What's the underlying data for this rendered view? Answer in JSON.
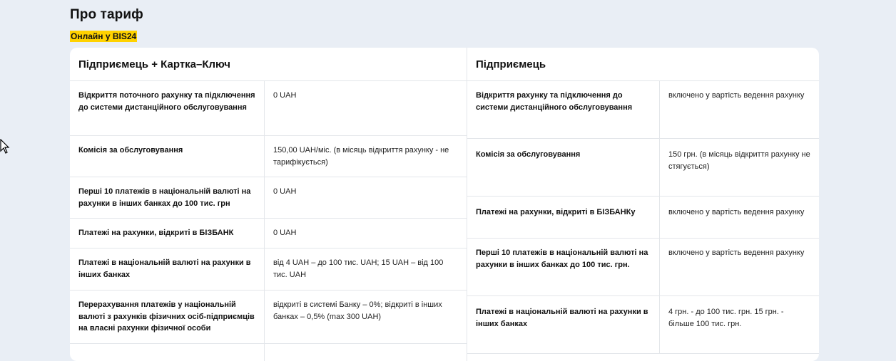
{
  "page": {
    "title": "Про тариф",
    "badge": "Онлайн у BIS24"
  },
  "left": {
    "heading": "Підприємець + Картка–Ключ",
    "rows": [
      {
        "label": "Відкриття поточного рахунку  та підключення до системи дистанційного обслуговування",
        "value": "0 UAH"
      },
      {
        "label": "Комісія за обслуговування",
        "value": "150,00 UAH/міс. (в місяць відкриття рахунку - не тарифікується)"
      },
      {
        "label": "Перші 10 платежів в національній валюті на рахунки в інших банках  до 100 тис. грн",
        "value": "0 UAH"
      },
      {
        "label": "Платежі на рахунки, відкриті  в БІЗБАНК",
        "value": "0 UAH"
      },
      {
        "label": "Платежі в національній валюті на рахунки в інших банках",
        "value": "від 4 UAH – до 100 тис. UAH; 15 UAH – від 100 тис. UAH"
      },
      {
        "label": "Перерахування платежів у національній валюті з рахунків фізичних осіб-підприємців на власні рахунки фізичної особи",
        "value": "відкриті в системі Банку – 0%; відкриті в інших банках – 0,5% (max 300 UAH)"
      }
    ]
  },
  "right": {
    "heading": "Підприємець",
    "rows": [
      {
        "label": "Відкриття рахунку та підключення до системи дистанційного обслуговування",
        "value": "включено у вартість ведення рахунку"
      },
      {
        "label": "Комісія за обслуговування",
        "value": "150 грн. (в місяць відкриття рахунку не стягується)"
      },
      {
        "label": "Платежі на рахунки, відкриті в БІЗБАНКу",
        "value": "включено у вартість ведення рахунку"
      },
      {
        "label": "Перші 10 платежів в національній валюті на рахунки в інших банках до 100 тис. грн.",
        "value": "включено у вартість ведення рахунку"
      },
      {
        "label": "Платежі в національній валюті на рахунки в інших банках",
        "value": "4 грн. - до 100 тис. грн. 15 грн. - більше 100 тис. грн."
      }
    ]
  }
}
